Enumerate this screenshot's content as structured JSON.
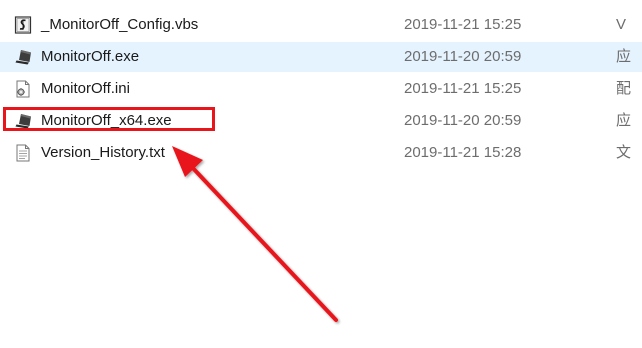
{
  "files": [
    {
      "name": "_MonitorOff_Config.vbs",
      "date": "2019-11-21 15:25",
      "type": "V",
      "icon": "vbs-script-icon",
      "selected": false
    },
    {
      "name": "MonitorOff.exe",
      "date": "2019-11-20 20:59",
      "type": "应",
      "icon": "monitor-exe-icon",
      "selected": true
    },
    {
      "name": "MonitorOff.ini",
      "date": "2019-11-21 15:25",
      "type": "配",
      "icon": "ini-settings-icon",
      "selected": false
    },
    {
      "name": "MonitorOff_x64.exe",
      "date": "2019-11-20 20:59",
      "type": "应",
      "icon": "monitor-exe-icon",
      "selected": false
    },
    {
      "name": "Version_History.txt",
      "date": "2019-11-21 15:28",
      "type": "文",
      "icon": "text-document-icon",
      "selected": false
    }
  ],
  "annotation": {
    "highlight_color": "#e8151a",
    "arrow_color": "#e8151a",
    "target": "MonitorOff_x64.exe"
  }
}
